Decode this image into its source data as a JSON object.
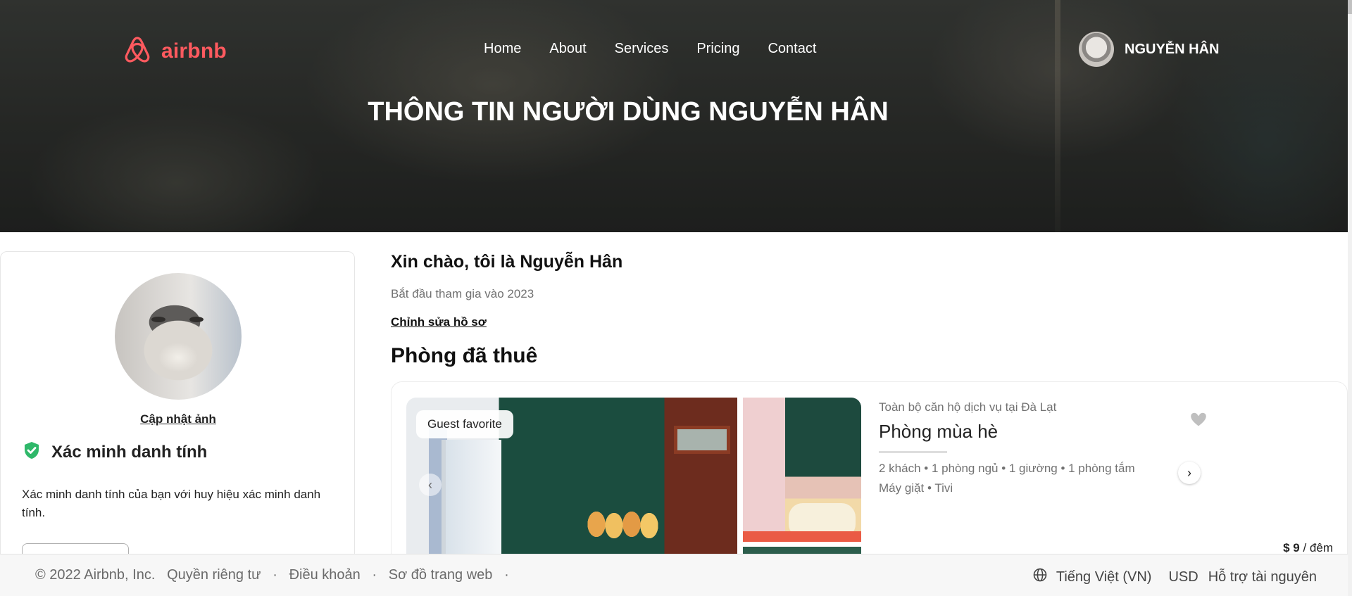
{
  "brand": {
    "name": "airbnb",
    "color": "#ff5a5f",
    "icon": "airbnb-logo-icon"
  },
  "nav": {
    "items": [
      {
        "label": "Home"
      },
      {
        "label": "About"
      },
      {
        "label": "Services"
      },
      {
        "label": "Pricing"
      },
      {
        "label": "Contact"
      }
    ]
  },
  "user": {
    "name": "NGUYỄN HÂN"
  },
  "hero": {
    "title": "THÔNG TIN NGƯỜI DÙNG NGUYỄN HÂN"
  },
  "profile": {
    "update_photo": "Cập nhật ảnh",
    "verify_title": "Xác minh danh tính",
    "verify_desc": "Xác minh danh tính của bạn với huy hiệu xác minh danh tính.",
    "verify_icon": "shield-check-icon"
  },
  "main": {
    "greeting": "Xin chào, tôi là Nguyễn Hân",
    "joined": "Bắt đầu tham gia vào 2023",
    "edit_profile": "Chỉnh sửa hồ sơ",
    "rented_heading": "Phòng đã thuê"
  },
  "room": {
    "badge": "Guest favorite",
    "subtitle": "Toàn bộ căn hộ dịch vụ tại Đà Lạt",
    "title": "Phòng mùa hè",
    "specs": "2 khách • 1 phòng ngủ • 1 giường • 1 phòng tắm",
    "amenities": "Máy giặt • Tivi",
    "price": "$ 9",
    "price_unit": " / đêm"
  },
  "footer": {
    "copyright": "© 2022 Airbnb, Inc.",
    "links": [
      "Quyền riêng tư",
      "Điều khoản",
      "Sơ đồ trang web"
    ],
    "separator": "·",
    "language": "Tiếng Việt (VN)",
    "currency": "USD",
    "support": "Hỗ trợ tài nguyên"
  },
  "colors": {
    "accent": "#ff5a5f",
    "verify_green": "#2fb86a"
  }
}
